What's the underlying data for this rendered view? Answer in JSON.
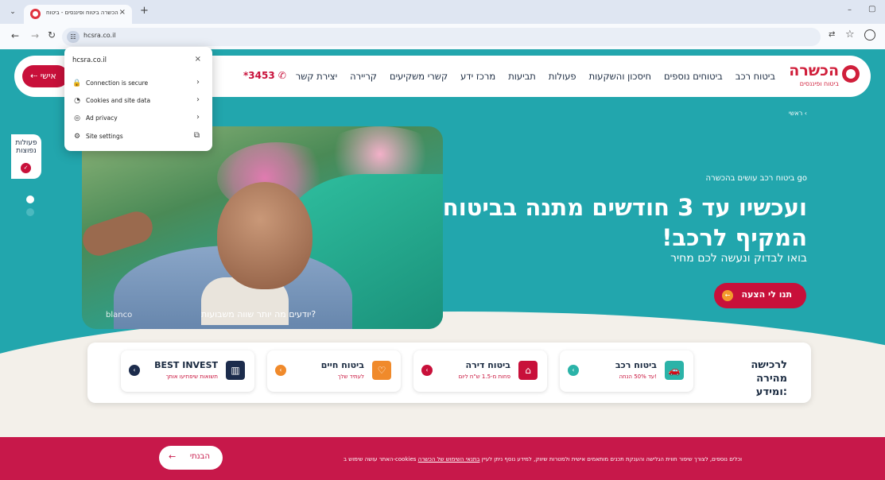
{
  "browser": {
    "tab_title": "הכשרה ביטוח ופיננסים - ביטוח",
    "tab_close": "×",
    "new_tab": "+",
    "url": "hcsra.co.il",
    "win_min": "–",
    "win_max": "▢"
  },
  "popup": {
    "domain": "hcsra.co.il",
    "close": "×",
    "rows": [
      {
        "icon": "🔒",
        "label": "Connection is secure",
        "chev": "›"
      },
      {
        "icon": "◔",
        "label": "Cookies and site data",
        "chev": "›"
      },
      {
        "icon": "◎",
        "label": "Ad privacy",
        "chev": "›"
      },
      {
        "icon": "⚙",
        "label": "Site settings",
        "chev": "⧉"
      }
    ]
  },
  "header": {
    "logo_text": "הכשרה",
    "logo_sub": "ביטוח ופיננסים",
    "nav": [
      "ביטוח רכב",
      "ביטוחים נוספים",
      "חיסכון והשקעות",
      "פעולות",
      "תביעות",
      "מרכז ידע",
      "קשרי משקיעים",
      "קריירה",
      "יצירת קשר"
    ],
    "phone": "*3453",
    "personal": "אישי"
  },
  "sidebar": {
    "pill_text": "פעולות נפוצות",
    "pill_icon": "✓"
  },
  "hero": {
    "breadcrumb": "ראשי  ‹",
    "brand": "blanco",
    "caption": "יודעים מה יותר שווה משבועות?",
    "eyebrow": "ביטוח רכב עושים בהכשרה go",
    "headline": "ועכשיו עד 3 חודשים מתנה בביטוח המקיף לרכב!",
    "subheadline": "בואו לבדוק ונעשה לכם מחיר",
    "cta": "תנו לי הצעה",
    "cta_arrow": "←"
  },
  "quick": {
    "title": "לרכישה מהירה ומידע:",
    "cards": [
      {
        "title": "ביטוח רכב",
        "sub": "עד 50% הנחה!",
        "icon": "🚗",
        "icon_color": "#2bb3a8",
        "arrow_color": "#2bb3a8"
      },
      {
        "title": "ביטוח דירה",
        "sub": "פחות מ-1.5 ש\"ח ליום",
        "icon": "⌂",
        "icon_color": "#c8103a",
        "arrow_color": "#c8103a"
      },
      {
        "title": "ביטוח חיים",
        "sub": "לעתיד שלך",
        "icon": "♡",
        "icon_color": "#f08a2b",
        "arrow_color": "#f08a2b"
      },
      {
        "title": "BEST INVEST",
        "sub": "תשואות שיפתיעו אותך",
        "icon": "▥",
        "icon_color": "#1c2c4c",
        "arrow_color": "#1c2c4c"
      }
    ],
    "arrow": "‹"
  },
  "cookie": {
    "text": "האתר עושה שימוש ב-cookies וכלים נוספים, לצורך שיפור חווית הגלישה והענקת תכנים מותאמים אישית ולמטרות שיווק, למידע נוסף ניתן לעיין ",
    "link": "בתנאי השימוש של הכשרה",
    "button": "הבנתי",
    "button_arrow": "←"
  }
}
